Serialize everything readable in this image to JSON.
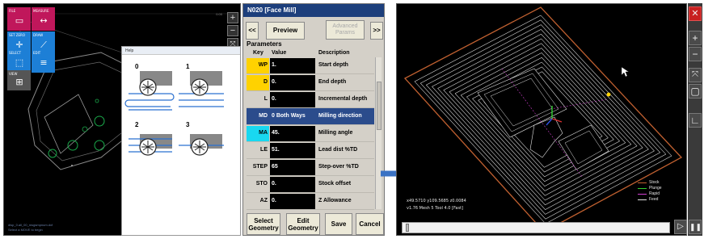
{
  "left_view": {
    "tiles": [
      {
        "label": "FILE",
        "icon": "file-icon",
        "color": "#c0175b"
      },
      {
        "label": "MEASURE",
        "icon": "measure-icon",
        "color": "#c0175b"
      },
      {
        "label": "SET ZERO",
        "icon": "crosshair-icon",
        "color": "#1d7fd6"
      },
      {
        "label": "DRAW",
        "icon": "draw-icon",
        "color": "#1d7fd6"
      },
      {
        "label": "SELECT",
        "icon": "select-icon",
        "color": "#1d7fd6"
      },
      {
        "label": "EDIT",
        "icon": "edit-icon",
        "color": "#1d7fd6"
      },
      {
        "label": "VIEW",
        "icon": "view-icon",
        "color": "#555555"
      }
    ],
    "zoom_readout": "0.00",
    "status_line1": "disp_0.all_00_msgsmpnum.dxf",
    "status_line2": "Select a MOVE to begin"
  },
  "help_window": {
    "title": "Help",
    "options": [
      "0",
      "1",
      "2",
      "3"
    ]
  },
  "panel": {
    "title": "N020 [Face Mill]",
    "prev_label": "<<",
    "preview_label": "Preview",
    "advanced_label": "Advanced Params",
    "next_label": ">>",
    "params_label": "Parameters",
    "columns": {
      "key": "Key",
      "value": "Value",
      "description": "Description"
    },
    "rows": [
      {
        "key": "WP",
        "value": "1.",
        "description": "Start depth",
        "key_bg": "#ffd200"
      },
      {
        "key": "D",
        "value": "0.",
        "description": "End depth",
        "key_bg": "#ffd200"
      },
      {
        "key": "L",
        "value": "0.",
        "description": "Incremental depth",
        "key_bg": ""
      },
      {
        "key": "MD",
        "value": "0 Both Ways",
        "description": "Milling direction",
        "key_bg": "#2b4c8c",
        "selected": true
      },
      {
        "key": "MA",
        "value": "45.",
        "description": "Milling angle",
        "key_bg": "#19d8f0"
      },
      {
        "key": "LE",
        "value": "51.",
        "description": "Lead dist %TD",
        "key_bg": ""
      },
      {
        "key": "STEP",
        "value": "65",
        "description": "Step-over %TD",
        "key_bg": ""
      },
      {
        "key": "STO",
        "value": "0.",
        "description": "Stock offset",
        "key_bg": ""
      },
      {
        "key": "AZ",
        "value": "0.",
        "description": "Z Allowance",
        "key_bg": ""
      }
    ],
    "select_geometry_label": "Select Geometry",
    "edit_geometry_label": "Edit Geometry",
    "save_label": "Save",
    "cancel_label": "Cancel"
  },
  "right_view": {
    "status_line1": "x49.5710 y109.5685 z0.0084",
    "status_line2": "v1.76 Mesh 5  Tool 4.0 [Fast]",
    "legend": [
      {
        "label": "Stock",
        "color": "#c06030"
      },
      {
        "label": "Plunge",
        "color": "#30d030"
      },
      {
        "label": "Rapid",
        "color": "#d040d0"
      },
      {
        "label": "Feed",
        "color": "#e0e0e0"
      }
    ]
  },
  "colors": {
    "accent": "#1d3f7c",
    "arrow": "#3a72c4"
  }
}
